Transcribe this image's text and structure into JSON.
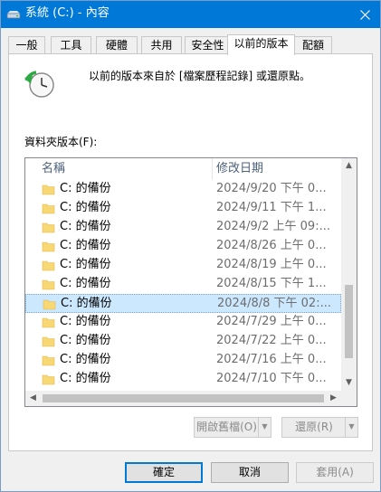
{
  "window": {
    "title": "系統 (C:) - 內容"
  },
  "tabs": [
    {
      "label": "一般"
    },
    {
      "label": "工具"
    },
    {
      "label": "硬體"
    },
    {
      "label": "共用"
    },
    {
      "label": "安全性"
    },
    {
      "label": "以前的版本",
      "active": true
    },
    {
      "label": "配額"
    }
  ],
  "panel": {
    "description": "以前的版本來自於 [檔案歷程記錄] 或還原點。",
    "list_label": "資料夾版本(F):",
    "columns": {
      "name": "名稱",
      "modified": "修改日期"
    },
    "rows": [
      {
        "name": "C: 的備份",
        "date": "2024/9/20 下午 0..."
      },
      {
        "name": "C: 的備份",
        "date": "2024/9/11 下午 1..."
      },
      {
        "name": "C: 的備份",
        "date": "2024/9/2 上午 09:..."
      },
      {
        "name": "C: 的備份",
        "date": "2024/8/26 上午 0..."
      },
      {
        "name": "C: 的備份",
        "date": "2024/8/19 上午 0..."
      },
      {
        "name": "C: 的備份",
        "date": "2024/8/15 下午 1..."
      },
      {
        "name": "C: 的備份",
        "date": "2024/8/8 下午 02:...",
        "selected": true
      },
      {
        "name": "C: 的備份",
        "date": "2024/7/29 上午 0..."
      },
      {
        "name": "C: 的備份",
        "date": "2024/7/22 上午 0..."
      },
      {
        "name": "C: 的備份",
        "date": "2024/7/16 上午 0..."
      },
      {
        "name": "C: 的備份",
        "date": "2024/7/10 下午 0..."
      }
    ],
    "open_label": "開啟舊檔(O)",
    "restore_label": "還原(R)"
  },
  "buttons": {
    "ok": "確定",
    "cancel": "取消",
    "apply": "套用(A)"
  },
  "colors": {
    "titlebar": "#0078d7",
    "selection": "#cce8ff",
    "folder": "#f8d775"
  }
}
